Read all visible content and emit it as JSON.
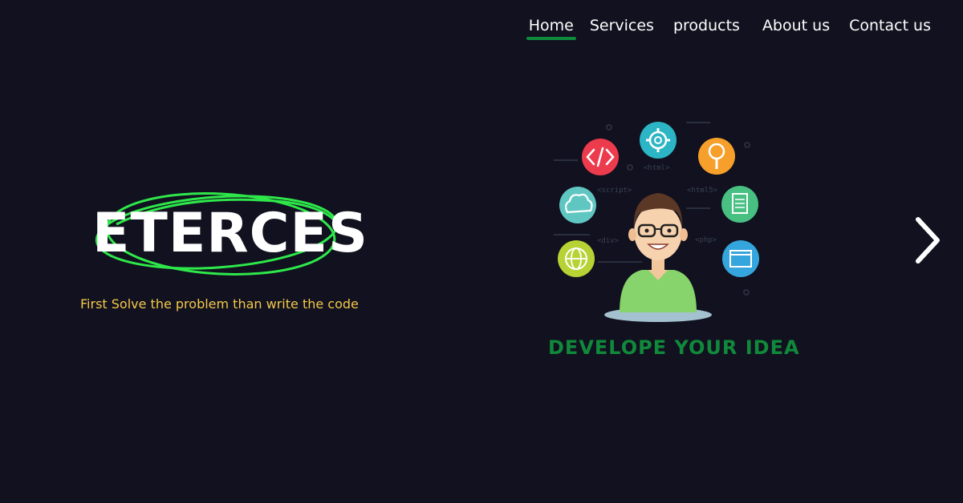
{
  "nav": {
    "items": [
      {
        "label": "Home",
        "active": true
      },
      {
        "label": "Services",
        "active": false
      },
      {
        "label": "products",
        "active": false
      },
      {
        "label": "About us",
        "active": false
      },
      {
        "label": "Contact us",
        "active": false
      }
    ]
  },
  "hero": {
    "brand": "ETERCES",
    "tagline": "First Solve the problem than write the code",
    "illustration_caption": "DEVELOPE YOUR IDEA",
    "code_tags": [
      "<html>",
      "<script>",
      "<html5>",
      "<div>",
      "<php>"
    ],
    "next_icon": "chevron-right-icon"
  },
  "colors": {
    "background": "#11111f",
    "nav_underline": "#0e8a3c",
    "brand_circle": "#2ee84a",
    "tagline": "#f4c84a",
    "caption": "#10893a"
  }
}
